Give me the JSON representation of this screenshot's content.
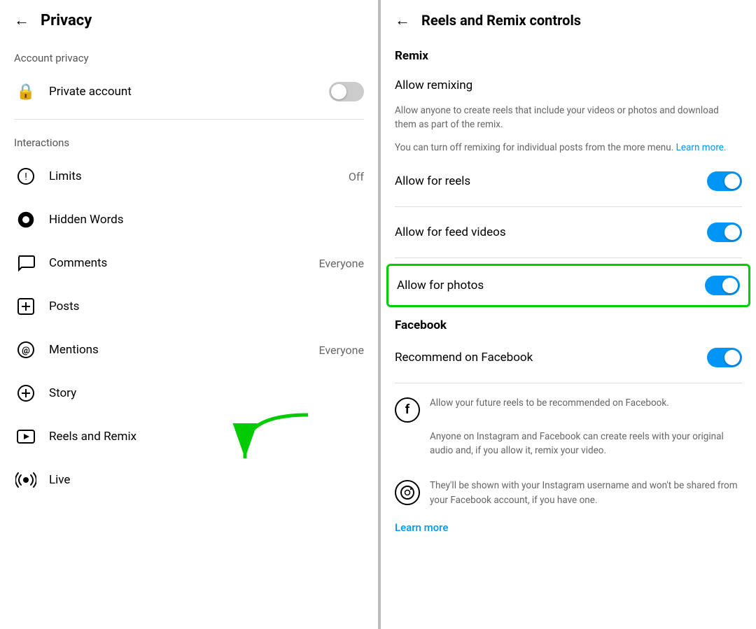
{
  "left": {
    "back_arrow": "←",
    "title": "Privacy",
    "sections": [
      {
        "label": "Account privacy",
        "items": [
          {
            "id": "private-account",
            "icon": "🔒",
            "label": "Private account",
            "toggle": "off",
            "value": ""
          }
        ]
      },
      {
        "label": "Interactions",
        "items": [
          {
            "id": "limits",
            "icon": "⊙",
            "label": "Limits",
            "toggle": "",
            "value": "Off"
          },
          {
            "id": "hidden-words",
            "icon": "◉",
            "label": "Hidden Words",
            "toggle": "",
            "value": ""
          },
          {
            "id": "comments",
            "icon": "○",
            "label": "Comments",
            "toggle": "",
            "value": "Everyone"
          },
          {
            "id": "posts",
            "icon": "⊕",
            "label": "Posts",
            "toggle": "",
            "value": ""
          },
          {
            "id": "mentions",
            "icon": "@",
            "label": "Mentions",
            "toggle": "",
            "value": "Everyone"
          },
          {
            "id": "story",
            "icon": "⊕",
            "label": "Story",
            "toggle": "",
            "value": ""
          },
          {
            "id": "reels-remix",
            "icon": "▶",
            "label": "Reels and Remix",
            "toggle": "",
            "value": ""
          },
          {
            "id": "live",
            "icon": "((·))",
            "label": "Live",
            "toggle": "",
            "value": ""
          }
        ]
      }
    ]
  },
  "right": {
    "back_arrow": "←",
    "title": "Reels and Remix controls",
    "remix_section_label": "Remix",
    "allow_remixing_label": "Allow remixing",
    "allow_remixing_desc1": "Allow anyone to create reels that include your videos or photos and download them as part of the remix.",
    "allow_remixing_desc2": "You can turn off remixing for individual posts from the more menu.",
    "learn_more_inline": "Learn more.",
    "allow_for_reels_label": "Allow for reels",
    "allow_for_feed_videos_label": "Allow for feed videos",
    "allow_for_photos_label": "Allow for photos",
    "facebook_section_label": "Facebook",
    "recommend_facebook_label": "Recommend on Facebook",
    "facebook_desc1": "Allow your future reels to be recommended on Facebook.",
    "facebook_desc2": "Anyone on Instagram and Facebook can create reels with your original audio and, if you allow it, remix your video.",
    "instagram_desc": "They'll be shown with your Instagram username and won't be shared from your Facebook account, if you have one.",
    "learn_more_bottom": "Learn more"
  }
}
